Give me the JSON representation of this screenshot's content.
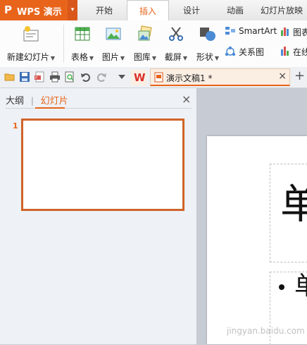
{
  "app": {
    "name": "WPS 演示",
    "logo_glyph": "P",
    "menu_arrow": "▾"
  },
  "tabs": [
    {
      "label": "开始"
    },
    {
      "label": "插入",
      "active": true
    },
    {
      "label": "设计"
    },
    {
      "label": "动画"
    },
    {
      "label": "幻灯片放映"
    }
  ],
  "ribbon": {
    "new_slide": "新建幻灯片",
    "table": "表格",
    "picture": "图片",
    "gallery": "图库",
    "screenshot": "截屏",
    "shapes": "形状",
    "smartart": "SmartArt",
    "relation": "关系图",
    "chart": "图表",
    "online": "在线"
  },
  "quickbar": {
    "wps_glyph": "W",
    "doc_tab_title": "演示文稿1 *",
    "close_glyph": "×",
    "add_glyph": "+"
  },
  "pane": {
    "outline_tab": "大纲",
    "divider": "|",
    "slides_tab": "幻灯片",
    "close_glyph": "×",
    "slide_number": "1"
  },
  "slide": {
    "title_text": "单",
    "body_text": "单"
  },
  "watermark": "jingyan.baidu.com",
  "colors": {
    "accent": "#e8641b",
    "thumb_border": "#d0642a"
  }
}
